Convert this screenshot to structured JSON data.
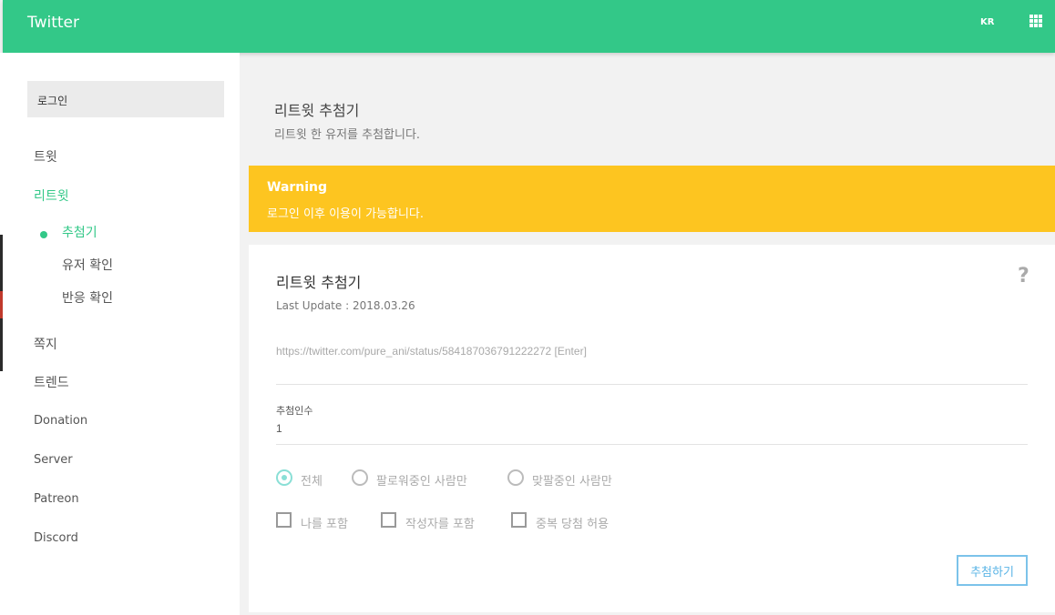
{
  "app": {
    "title": "Twitter",
    "lang": "KR"
  },
  "sidebar": {
    "login": "로그인",
    "items": [
      {
        "label": "트윗"
      },
      {
        "label": "리트윗"
      },
      {
        "label": "쪽지"
      },
      {
        "label": "트렌드"
      },
      {
        "label": "Donation"
      },
      {
        "label": "Server"
      },
      {
        "label": "Patreon"
      },
      {
        "label": "Discord"
      }
    ],
    "subitems": [
      {
        "label": "추첨기"
      },
      {
        "label": "유저 확인"
      },
      {
        "label": "반응 확인"
      }
    ]
  },
  "page": {
    "title": "리트윗 추첨기",
    "subtitle": "리트윗 한 유저를 추첨합니다."
  },
  "warning": {
    "title": "Warning",
    "message": "로그인 이후 이용이 가능합니다."
  },
  "card": {
    "title": "리트윗 추첨기",
    "updated": "Last Update : 2018.03.26",
    "url_placeholder": "https://twitter.com/pure_ani/status/584187036791222272 [Enter]",
    "count_label": "추첨인수",
    "count_value": "1",
    "radios": [
      {
        "label": "전체",
        "checked": true
      },
      {
        "label": "팔로워중인 사람만",
        "checked": false
      },
      {
        "label": "맞팔중인 사람만",
        "checked": false
      }
    ],
    "checkboxes": [
      {
        "label": "나를 포함"
      },
      {
        "label": "작성자를 포함"
      },
      {
        "label": "중복 당첨 허용"
      }
    ],
    "button": "추첨하기"
  },
  "colors": {
    "accent": "#33c888",
    "warning": "#fdc520",
    "button": "#5ab4e6"
  }
}
